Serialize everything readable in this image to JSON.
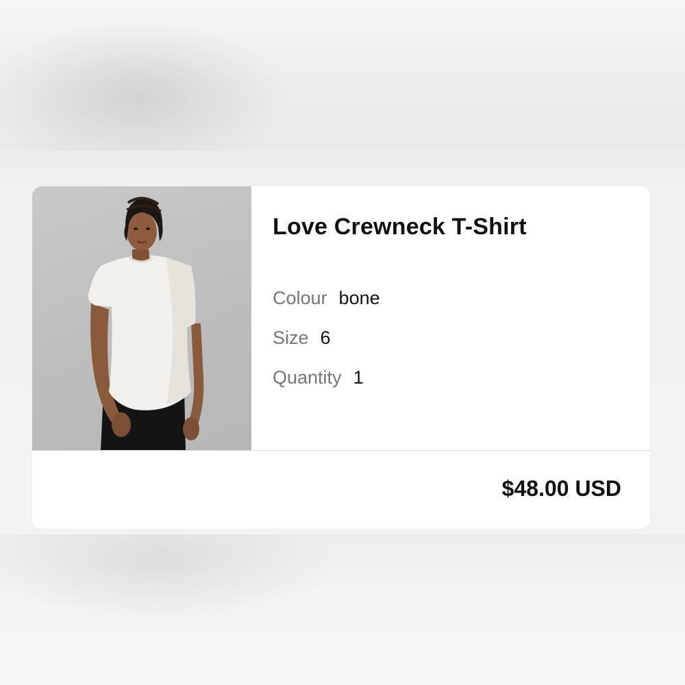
{
  "product": {
    "title": "Love Crewneck T-Shirt",
    "image_description_icon": "product-photo",
    "attributes": [
      {
        "label": "Colour",
        "value": "bone"
      },
      {
        "label": "Size",
        "value": "6"
      },
      {
        "label": "Quantity",
        "value": "1"
      }
    ],
    "price": "$48.00 USD"
  },
  "colors": {
    "card_background": "#ffffff",
    "text_primary": "#111111",
    "text_secondary": "#767676",
    "image_background": "#c2c2c2"
  }
}
